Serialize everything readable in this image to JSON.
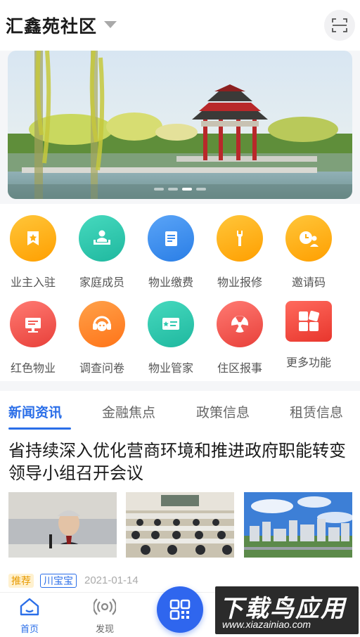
{
  "header": {
    "community_name": "汇鑫苑社区"
  },
  "banner": {
    "slides": 4,
    "active_slide": 3
  },
  "services": [
    {
      "label": "业主入驻",
      "icon": "owner-badge-icon",
      "color": "#ffb21a"
    },
    {
      "label": "家庭成员",
      "icon": "family-members-icon",
      "color": "#2fc9b0"
    },
    {
      "label": "物业缴费",
      "icon": "bill-payment-icon",
      "color": "#3f8ff1"
    },
    {
      "label": "物业报修",
      "icon": "wrench-repair-icon",
      "color": "#ffb21a"
    },
    {
      "label": "邀请码",
      "icon": "invite-code-icon",
      "color": "#ffb21a"
    },
    {
      "label": "红色物业",
      "icon": "red-property-icon",
      "color": "#f25c56"
    },
    {
      "label": "调查问卷",
      "icon": "survey-headset-icon",
      "color": "#ff8a28"
    },
    {
      "label": "物业管家",
      "icon": "property-steward-icon",
      "color": "#2fc9b0"
    },
    {
      "label": "住区报事",
      "icon": "report-incident-icon",
      "color": "#f25c56"
    },
    {
      "label": "更多功能",
      "icon": "more-functions-icon",
      "color": "#f04a3e"
    }
  ],
  "news": {
    "tabs": [
      "新闻资讯",
      "金融焦点",
      "政策信息",
      "租赁信息"
    ],
    "active_tab": 0,
    "headline": "省持续深入优化营商环境和推进政府职能转变领导小组召开会议",
    "tag_recommend": "推荐",
    "tag_source": "川宝宝",
    "date": "2021-01-14"
  },
  "bottom_nav": {
    "home_label": "首页",
    "discover_label": "发现"
  },
  "watermark": {
    "title": "下载鸟应用",
    "url": "www.xiazainiao.com"
  },
  "colors": {
    "accent": "#2a6ee8",
    "fab": "#2f66ee"
  }
}
